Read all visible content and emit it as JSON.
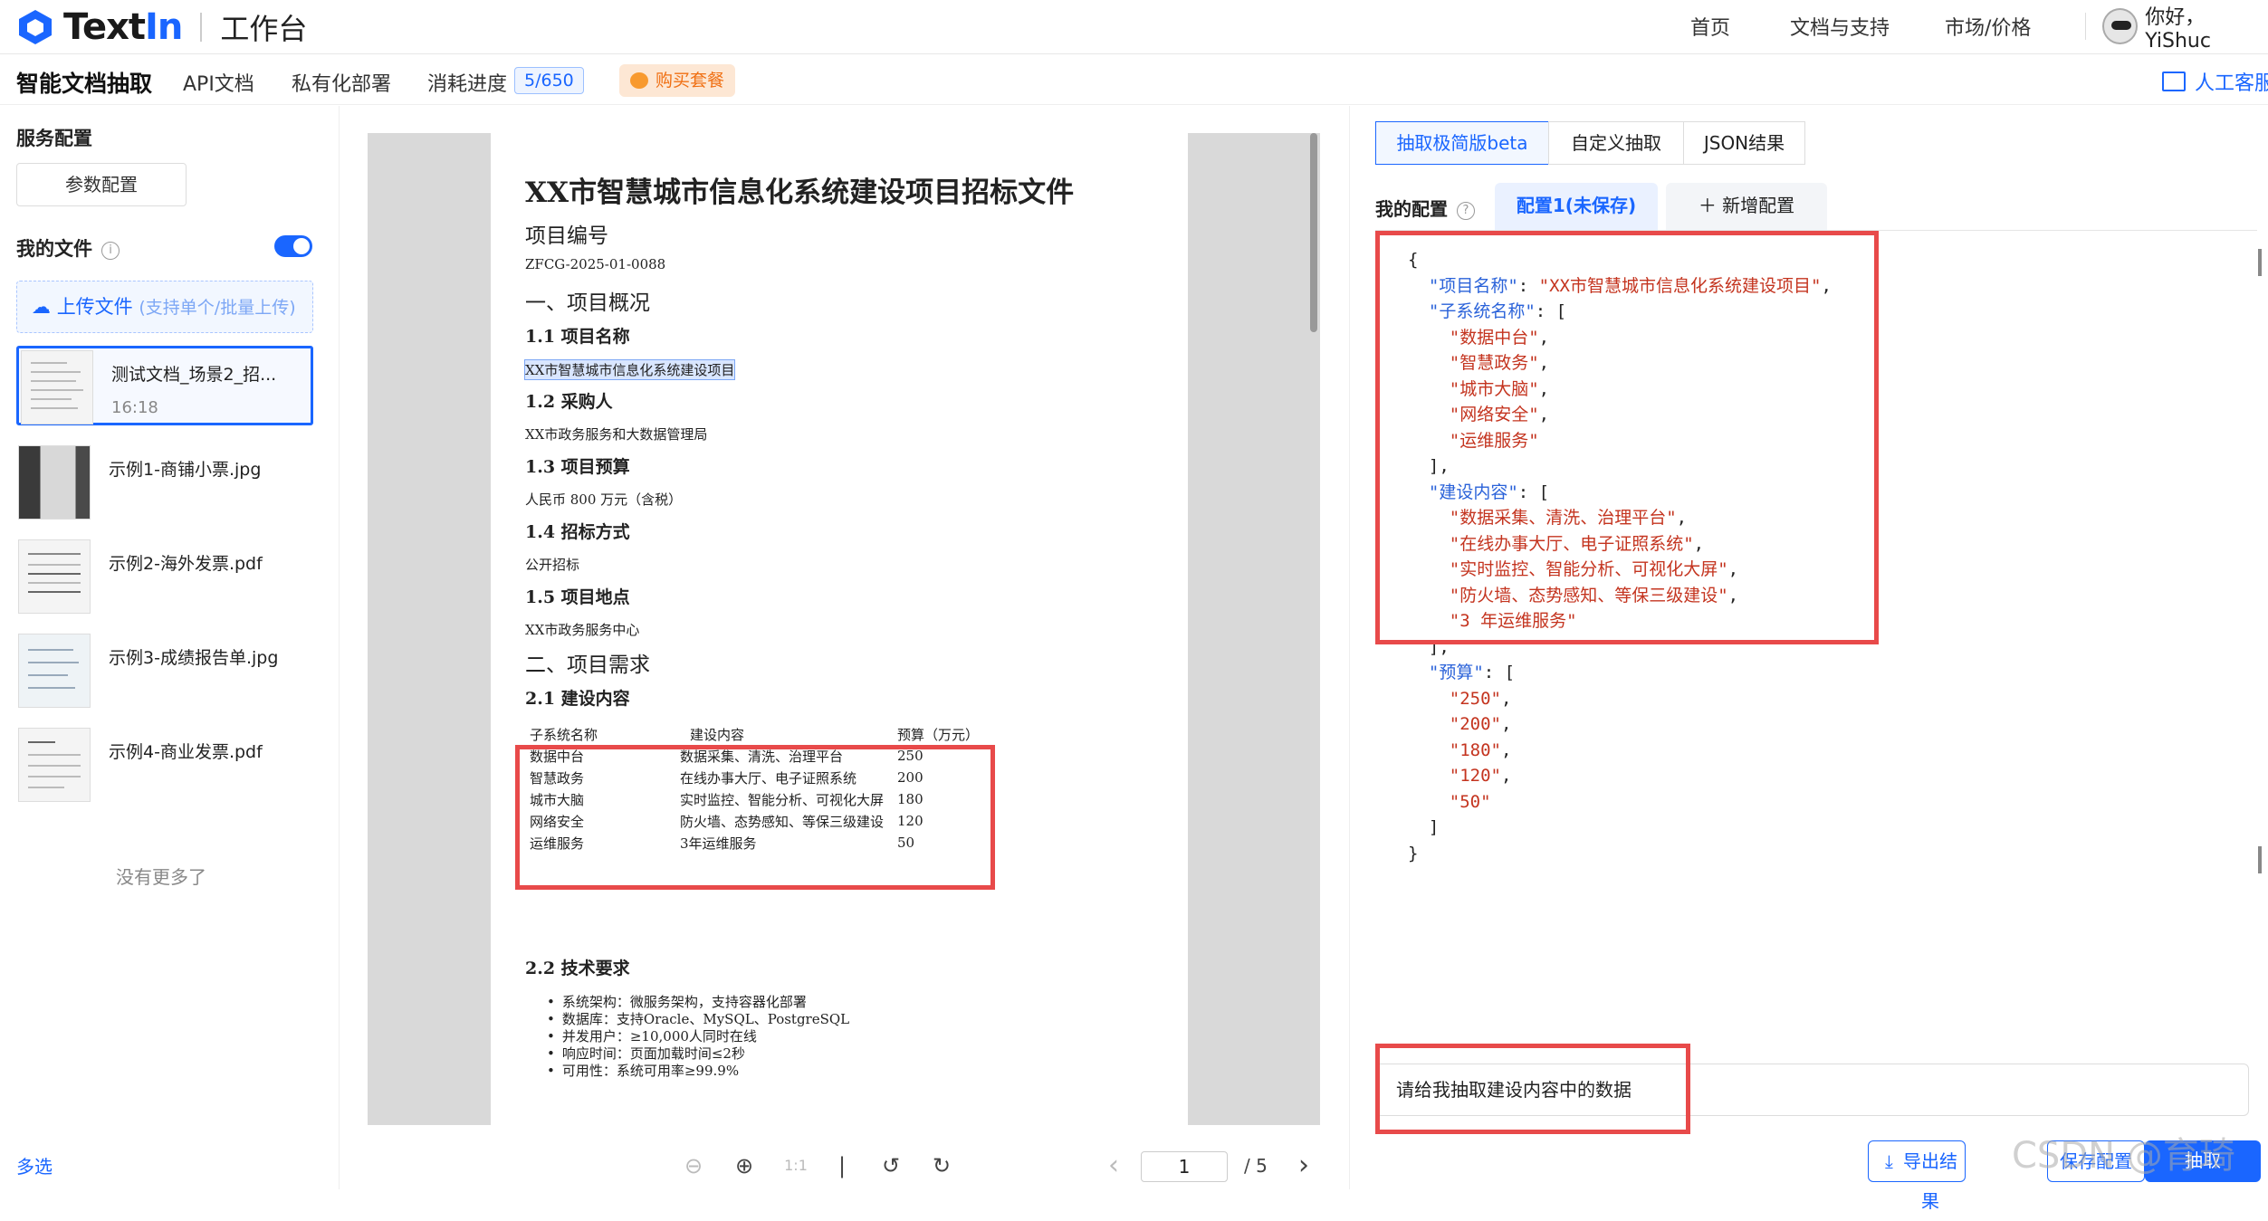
{
  "app": {
    "brand_text": "Text",
    "brand_in": "In",
    "brand_sub": "工作台",
    "nav": [
      "首页",
      "文档与支持",
      "市场/价格"
    ],
    "user_greeting": "你好，YiShuc"
  },
  "subbar": {
    "title": "智能文档抽取",
    "api_doc": "API文档",
    "private_deploy": "私有化部署",
    "usage_label": "消耗进度",
    "usage_value": "5/650",
    "buy": "购买套餐",
    "customer_service": "人工客服"
  },
  "sidebar": {
    "service_config": "服务配置",
    "param_button": "参数配置",
    "my_files": "我的文件",
    "upload_label": "上传文件",
    "upload_hint": "(支持单个/批量上传)",
    "files": [
      {
        "name": "测试文档_场景2_招...",
        "time": "16:18",
        "selected": true
      },
      {
        "name": "示例1-商铺小票.jpg",
        "time": ""
      },
      {
        "name": "示例2-海外发票.pdf",
        "time": ""
      },
      {
        "name": "示例3-成绩报告单.jpg",
        "time": ""
      },
      {
        "name": "示例4-商业发票.pdf",
        "time": ""
      }
    ],
    "no_more": "没有更多了",
    "multi_select": "多选"
  },
  "document": {
    "title": "XX市智慧城市信息化系统建设项目招标文件",
    "h_proj_no": "项目编号",
    "proj_no": "ZFCG-2025-01-0088",
    "s1": "一、项目概况",
    "s1_1": "1.1 项目名称",
    "s1_1_v": "XX市智慧城市信息化系统建设项目",
    "s1_2": "1.2 采购人",
    "s1_2_v": "XX市政务服务和大数据管理局",
    "s1_3": "1.3 项目预算",
    "s1_3_v": "人民币 800 万元（含税）",
    "s1_4": "1.4 招标方式",
    "s1_4_v": "公开招标",
    "s1_5": "1.5 项目地点",
    "s1_5_v": "XX市政务服务中心",
    "s2": "二、项目需求",
    "s2_1": "2.1 建设内容",
    "table_headers": [
      "子系统名称",
      "建设内容",
      "预算（万元）"
    ],
    "table_rows": [
      [
        "数据中台",
        "数据采集、清洗、治理平台",
        "250"
      ],
      [
        "智慧政务",
        "在线办事大厅、电子证照系统",
        "200"
      ],
      [
        "城市大脑",
        "实时监控、智能分析、可视化大屏",
        "180"
      ],
      [
        "网络安全",
        "防火墙、态势感知、等保三级建设",
        "120"
      ],
      [
        "运维服务",
        "3年运维服务",
        "50"
      ]
    ],
    "s2_2": "2.2 技术要求",
    "bullets": [
      "系统架构：微服务架构，支持容器化部署",
      "数据库：支持Oracle、MySQL、PostgreSQL",
      "并发用户：≥10,000人同时在线",
      "响应时间：页面加载时间≤2秒",
      "可用性：系统可用率≥99.9%"
    ]
  },
  "viewer": {
    "page_current": "1",
    "page_total": "/ 5"
  },
  "right": {
    "tabs": [
      "抽取极简版beta",
      "自定义抽取",
      "JSON结果"
    ],
    "my_config": "我的配置",
    "config_tab": "配置1(未保存)",
    "add_config": "新增配置",
    "json_lines": [
      [
        [
          "p2",
          "{"
        ]
      ],
      [
        [
          "p2",
          "  "
        ],
        [
          "k",
          "\"项目名称\""
        ],
        [
          "p2",
          ": "
        ],
        [
          "s",
          "\"XX市智慧城市信息化系统建设项目\""
        ],
        [
          "p2",
          ","
        ]
      ],
      [
        [
          "p2",
          "  "
        ],
        [
          "k",
          "\"子系统名称\""
        ],
        [
          "p2",
          ": ["
        ]
      ],
      [
        [
          "p2",
          "    "
        ],
        [
          "s",
          "\"数据中台\""
        ],
        [
          "p2",
          ","
        ]
      ],
      [
        [
          "p2",
          "    "
        ],
        [
          "s",
          "\"智慧政务\""
        ],
        [
          "p2",
          ","
        ]
      ],
      [
        [
          "p2",
          "    "
        ],
        [
          "s",
          "\"城市大脑\""
        ],
        [
          "p2",
          ","
        ]
      ],
      [
        [
          "p2",
          "    "
        ],
        [
          "s",
          "\"网络安全\""
        ],
        [
          "p2",
          ","
        ]
      ],
      [
        [
          "p2",
          "    "
        ],
        [
          "s",
          "\"运维服务\""
        ]
      ],
      [
        [
          "p2",
          "  ],"
        ]
      ],
      [
        [
          "p2",
          "  "
        ],
        [
          "k",
          "\"建设内容\""
        ],
        [
          "p2",
          ": ["
        ]
      ],
      [
        [
          "p2",
          "    "
        ],
        [
          "s",
          "\"数据采集、清洗、治理平台\""
        ],
        [
          "p2",
          ","
        ]
      ],
      [
        [
          "p2",
          "    "
        ],
        [
          "s",
          "\"在线办事大厅、电子证照系统\""
        ],
        [
          "p2",
          ","
        ]
      ],
      [
        [
          "p2",
          "    "
        ],
        [
          "s",
          "\"实时监控、智能分析、可视化大屏\""
        ],
        [
          "p2",
          ","
        ]
      ],
      [
        [
          "p2",
          "    "
        ],
        [
          "s",
          "\"防火墙、态势感知、等保三级建设\""
        ],
        [
          "p2",
          ","
        ]
      ],
      [
        [
          "p2",
          "    "
        ],
        [
          "s",
          "\"3 年运维服务\""
        ]
      ],
      [
        [
          "p2",
          "  ],"
        ]
      ],
      [
        [
          "p2",
          "  "
        ],
        [
          "k",
          "\"预算\""
        ],
        [
          "p2",
          ": ["
        ]
      ],
      [
        [
          "p2",
          "    "
        ],
        [
          "s",
          "\"250\""
        ],
        [
          "p2",
          ","
        ]
      ],
      [
        [
          "p2",
          "    "
        ],
        [
          "s",
          "\"200\""
        ],
        [
          "p2",
          ","
        ]
      ],
      [
        [
          "p2",
          "    "
        ],
        [
          "s",
          "\"180\""
        ],
        [
          "p2",
          ","
        ]
      ],
      [
        [
          "p2",
          "    "
        ],
        [
          "s",
          "\"120\""
        ],
        [
          "p2",
          ","
        ]
      ],
      [
        [
          "p2",
          "    "
        ],
        [
          "s",
          "\"50\""
        ]
      ],
      [
        [
          "p2",
          "  ]"
        ]
      ],
      [
        [
          "p2",
          "}"
        ]
      ]
    ],
    "prompt": "请给我抽取建设内容中的数据",
    "export": "导出结果",
    "save": "保存配置",
    "extract": "抽取"
  },
  "watermark": "CSDN @育琦",
  "colors": {
    "accent": "#1a66ff",
    "highlight_box": "#e84a4a",
    "json_key": "#2a62d9",
    "json_string": "#c4341f"
  }
}
